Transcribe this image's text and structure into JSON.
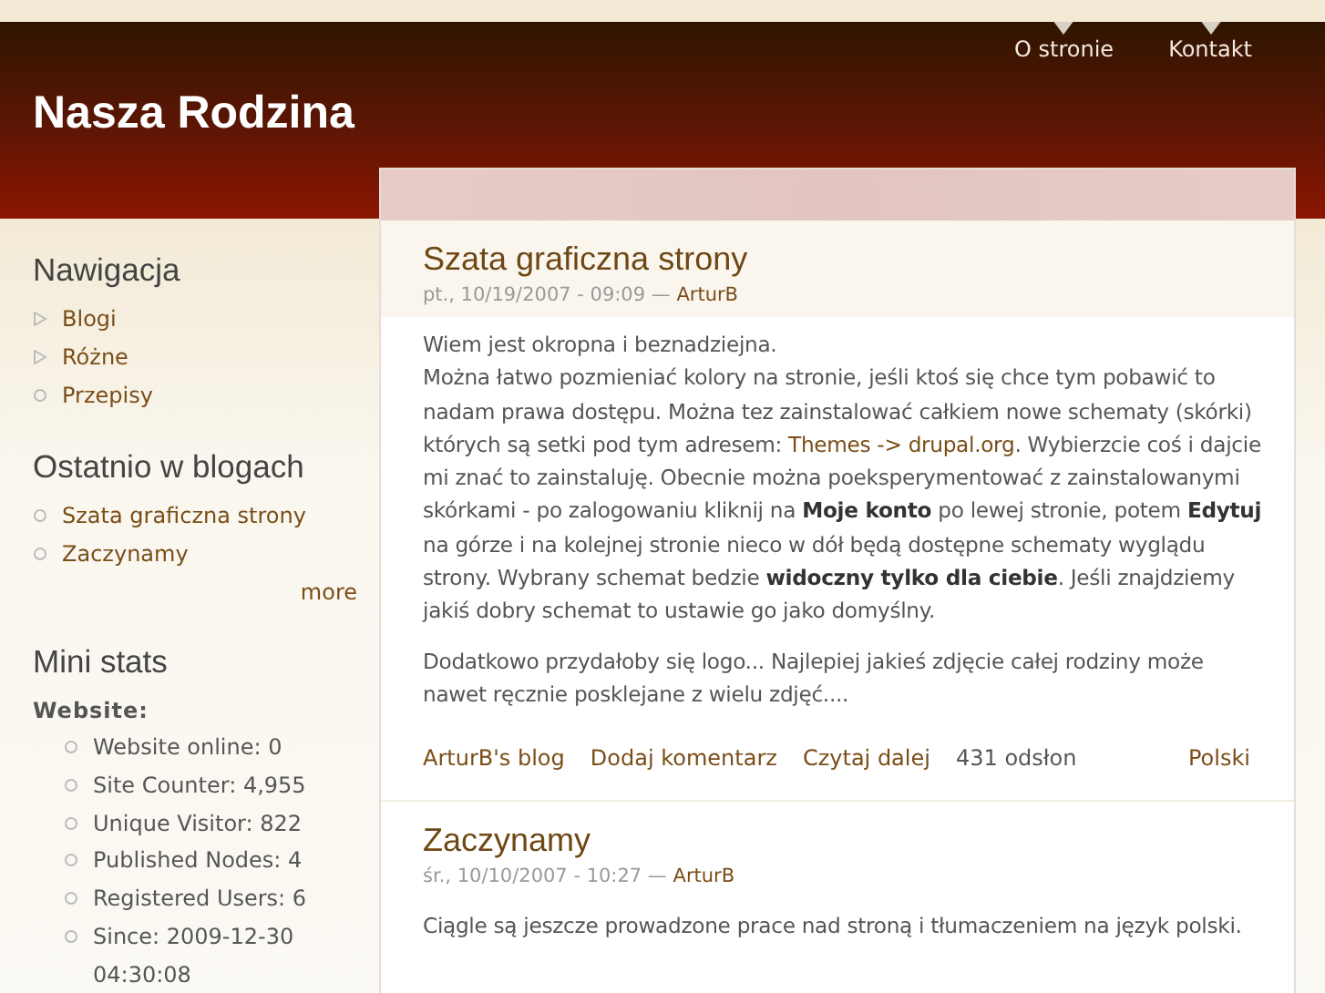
{
  "site_title": "Nasza Rodzina",
  "top_links": [
    "O stronie",
    "Kontakt"
  ],
  "sidebar": {
    "blocks": [
      {
        "kind": "menu",
        "title": "Nawigacja",
        "items": [
          {
            "label": "Blogi",
            "kind": "collapsed"
          },
          {
            "label": "Różne",
            "kind": "collapsed"
          },
          {
            "label": "Przepisy",
            "kind": "leaf"
          }
        ]
      },
      {
        "kind": "recent",
        "title": "Ostatnio w blogach",
        "items": [
          {
            "label": "Szata graficzna strony",
            "kind": "leaf"
          },
          {
            "label": "Zaczynamy",
            "kind": "leaf"
          }
        ],
        "more": "more"
      },
      {
        "kind": "stats",
        "title": "Mini stats",
        "heading": "Website:",
        "items": [
          "Website online: 0",
          "Site Counter: 4,955",
          "Unique Visitor: 822",
          "Published Nodes: 4",
          "Registered Users: 6",
          "Since: 2009-12-30 04:30:08"
        ]
      }
    ]
  },
  "posts": [
    {
      "title": "Szata graficzna strony",
      "date": "pt., 10/19/2007 - 09:09 —",
      "author": "ArturB",
      "paragraphs": [
        {
          "kind": "line",
          "segments": [
            {
              "kind": "text",
              "text": "Wiem jest okropna i beznadziejna."
            }
          ]
        },
        {
          "kind": "para",
          "segments": [
            {
              "kind": "text",
              "text": "Można łatwo pozmieniać kolory na stronie, jeśli ktoś się chce tym pobawić to nadam prawa dostępu. Można tez zainstalować całkiem nowe schematy (skórki) których są setki pod tym adresem: "
            },
            {
              "kind": "link",
              "text": "Themes -> drupal.org"
            },
            {
              "kind": "text",
              "text": ". Wybierzcie coś i dajcie mi znać to zainstaluję. Obecnie można poeksperymentować z zainstalowanymi skórkami - po zalogowaniu kliknij na **Moje konto** po lewej stronie, potem **Edytuj** na górze i na kolejnej stronie nieco w dół będą dostępne schematy wyglądu strony. Wybrany schemat bedzie **widoczny tylko dla ciebie**. Jeśli znajdziemy jakiś dobry schemat to ustawie go jako domyślny."
            }
          ]
        },
        {
          "kind": "para",
          "segments": [
            {
              "kind": "text",
              "text": "Dodatkowo przydałoby się logo... Najlepiej jakieś zdjęcie całej rodziny może nawet ręcznie posklejane z wielu zdjęć...."
            }
          ]
        }
      ],
      "links": [
        "ArturB's blog",
        "Dodaj komentarz",
        "Czytaj dalej"
      ],
      "views": "431 odsłon",
      "language": "Polski"
    },
    {
      "title": "Zaczynamy",
      "date": "śr., 10/10/2007 - 10:27 —",
      "author": "ArturB",
      "paragraphs": [
        {
          "kind": "para",
          "segments": [
            {
              "kind": "text",
              "text": "Ciągle są jeszcze prowadzone prace nad stroną i tłumaczeniem na język polski."
            }
          ]
        }
      ]
    }
  ]
}
